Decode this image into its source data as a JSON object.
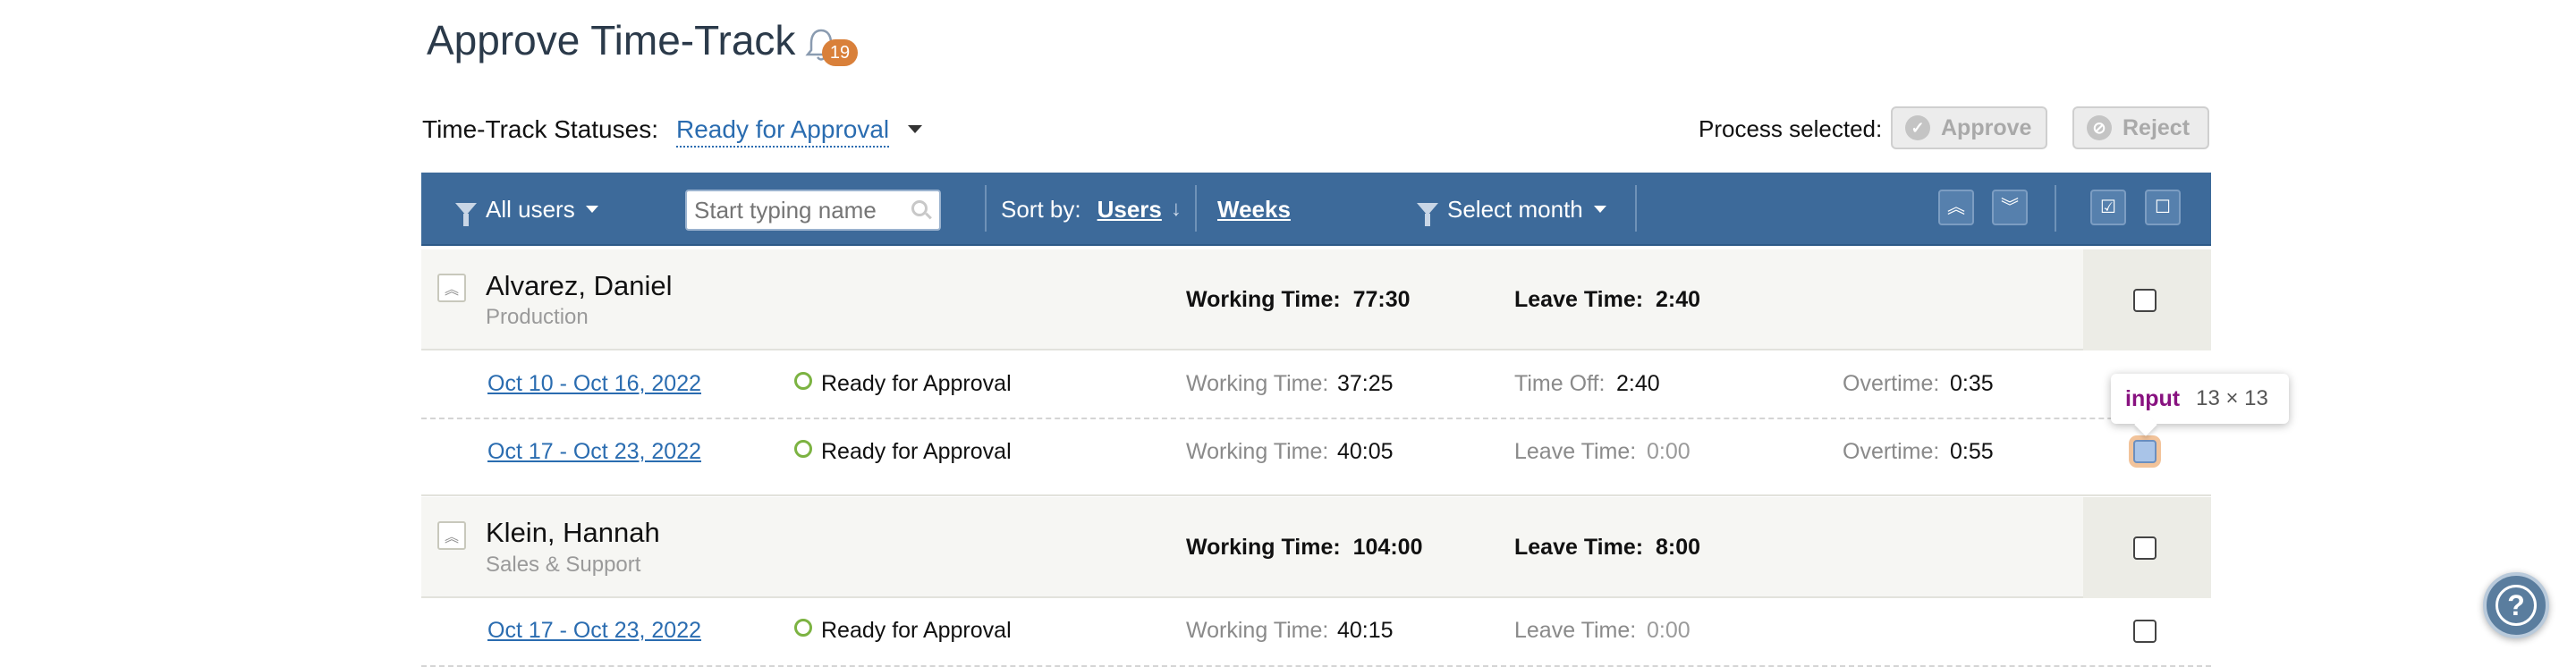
{
  "header": {
    "title": "Approve Time-Track",
    "notifications_count": "19"
  },
  "filters": {
    "status_label": "Time-Track Statuses:",
    "status_value": "Ready for Approval",
    "process_label": "Process selected:",
    "approve_label": "Approve",
    "reject_label": "Reject"
  },
  "toolbar": {
    "users_filter": "All users",
    "search_placeholder": "Start typing name",
    "sort_label": "Sort by:",
    "sort_users": "Users",
    "sort_weeks": "Weeks",
    "month_filter": "Select month"
  },
  "groups": [
    {
      "name": "Alvarez, Daniel",
      "department": "Production",
      "working_label": "Working Time:",
      "working_value": "77:30",
      "leave_label": "Leave Time:",
      "leave_value": "2:40",
      "weeks": [
        {
          "range": "Oct 10 - Oct 16, 2022",
          "status": "Ready for Approval",
          "working_label": "Working Time:",
          "working_value": "37:25",
          "second_label": "Time Off:",
          "second_value": "2:40",
          "overtime_label": "Overtime:",
          "overtime_value": "0:35"
        },
        {
          "range": "Oct 17 - Oct 23, 2022",
          "status": "Ready for Approval",
          "working_label": "Working Time:",
          "working_value": "40:05",
          "second_label": "Leave Time:",
          "second_value": "0:00",
          "overtime_label": "Overtime:",
          "overtime_value": "0:55"
        }
      ]
    },
    {
      "name": "Klein, Hannah",
      "department": "Sales & Support",
      "working_label": "Working Time:",
      "working_value": "104:00",
      "leave_label": "Leave Time:",
      "leave_value": "8:00",
      "weeks": [
        {
          "range": "Oct 17 - Oct 23, 2022",
          "status": "Ready for Approval",
          "working_label": "Working Time:",
          "working_value": "40:15",
          "second_label": "Leave Time:",
          "second_value": "0:00"
        }
      ]
    }
  ],
  "tooltip": {
    "tag": "input",
    "dimensions": "13 × 13"
  },
  "colors": {
    "toolbar_bg": "#3d6a9a",
    "link": "#2a6cb0",
    "badge": "#d9803a",
    "status_ok": "#7cb342"
  }
}
